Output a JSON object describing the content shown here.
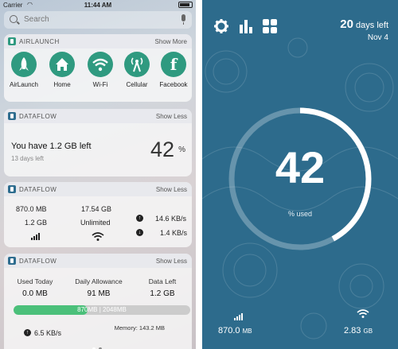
{
  "status": {
    "carrier": "Carrier",
    "time": "11:44 AM"
  },
  "search": {
    "placeholder": "Search"
  },
  "airlaunch": {
    "name": "AIRLAUNCH",
    "action": "Show More",
    "items": [
      {
        "label": "AirLaunch",
        "icon": "rocket-icon"
      },
      {
        "label": "Home",
        "icon": "home-icon"
      },
      {
        "label": "Wi-Fi",
        "icon": "wifi-icon"
      },
      {
        "label": "Cellular",
        "icon": "cellular-tower-icon"
      },
      {
        "label": "Facebook",
        "icon": "facebook-icon",
        "glyph": "f"
      }
    ]
  },
  "dataflow1": {
    "name": "DATAFLOW",
    "action": "Show Less",
    "message": "You have 1.2 GB left",
    "days_left": "13 days left",
    "percent": "42",
    "percent_sign": "%"
  },
  "dataflow2": {
    "name": "DATAFLOW",
    "action": "Show Less",
    "cell_used": "870.0 MB",
    "cell_left": "1.2 GB",
    "wifi_used": "17.54 GB",
    "wifi_plan": "Unlimited",
    "upload": "14.6 KB/s",
    "download": "1.4 KB/s"
  },
  "dataflow3": {
    "name": "DATAFLOW",
    "action": "Show Less",
    "used_label": "Used Today",
    "used_value": "0.0 MB",
    "allowance_label": "Daily Allowance",
    "allowance_value": "91 MB",
    "left_label": "Data Left",
    "left_value": "1.2 GB",
    "progress_text": "870MB | 2048MB",
    "progress_fraction": 0.42,
    "memory": "Memory: 143.2 MB",
    "speed": "6.5 KB/s"
  },
  "app": {
    "days_number": "20",
    "days_text": "days left",
    "date": "Nov 4",
    "percent": "42",
    "percent_label": "% used",
    "used_fraction": 0.42,
    "cell_value": "870.0",
    "cell_unit": "MB",
    "wifi_value": "2.83",
    "wifi_unit": "GB"
  },
  "colors": {
    "airlaunch_green": "#2f9a80",
    "dataflow_blue": "#2d6b8c",
    "progress_green": "#4bc07a"
  }
}
